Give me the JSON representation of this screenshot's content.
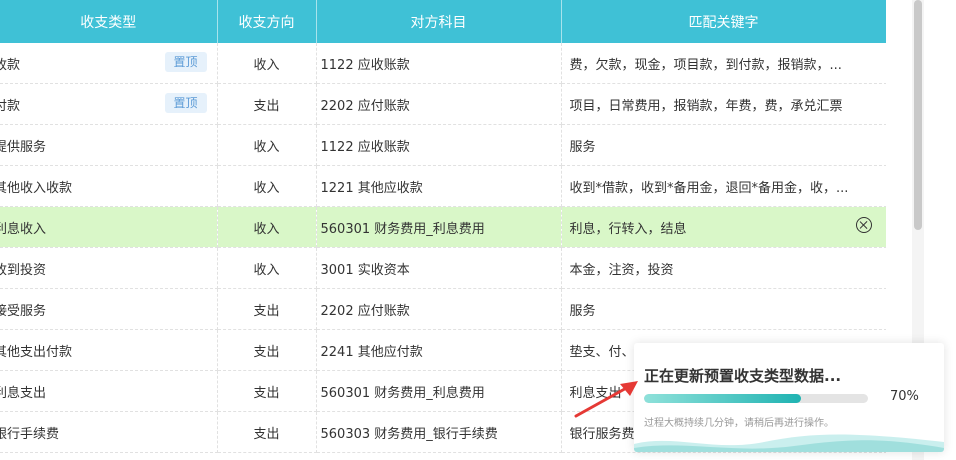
{
  "table": {
    "headers": [
      "收支类型",
      "收支方向",
      "对方科目",
      "匹配关键字"
    ],
    "pin_label": "置顶",
    "rows": [
      {
        "type": "收款",
        "direction": "收入",
        "account": "1122 应收账款",
        "keywords": "费，欠款，现金，项目款，到付款，报销款，...",
        "pinned": true
      },
      {
        "type": "付款",
        "direction": "支出",
        "account": "2202 应付账款",
        "keywords": "项目，日常费用，报销款，年费，费，承兑汇票",
        "pinned": true
      },
      {
        "type": "提供服务",
        "direction": "收入",
        "account": "1122 应收账款",
        "keywords": "服务",
        "pinned": false
      },
      {
        "type": "其他收入收款",
        "direction": "收入",
        "account": "1221 其他应收款",
        "keywords": "收到*借款，收到*备用金，退回*备用金，收，...",
        "pinned": false
      },
      {
        "type": "利息收入",
        "direction": "收入",
        "account": "560301 财务费用_利息费用",
        "keywords": "利息，行转入，结息",
        "pinned": false,
        "highlight": true
      },
      {
        "type": "收到投资",
        "direction": "收入",
        "account": "3001 实收资本",
        "keywords": "本金，注资，投资",
        "pinned": false
      },
      {
        "type": "接受服务",
        "direction": "支出",
        "account": "2202 应付账款",
        "keywords": "服务",
        "pinned": false
      },
      {
        "type": "其他支出付款",
        "direction": "支出",
        "account": "2241 其他应付款",
        "keywords": "垫支、付、",
        "pinned": false
      },
      {
        "type": "利息支出",
        "direction": "支出",
        "account": "560301 财务费用_利息费用",
        "keywords": "利息支出",
        "pinned": false
      },
      {
        "type": "银行手续费",
        "direction": "支出",
        "account": "560303 财务费用_银行手续费",
        "keywords": "银行服务费",
        "pinned": false
      }
    ]
  },
  "progress": {
    "title": "正在更新预置收支类型数据...",
    "percent_label": "70%",
    "percent": 70,
    "hint": "过程大概持续几分钟，请稍后再进行操作。"
  },
  "colors": {
    "header_bg": "#3fc1d6",
    "highlight_row": "#d9f7c8",
    "pin_bg": "#e6f1fb",
    "progress_fill": "#1fb3b2",
    "arrow": "#e53935"
  },
  "icons": {
    "clear": "circle-x-icon",
    "arrow": "red-arrow-icon"
  }
}
